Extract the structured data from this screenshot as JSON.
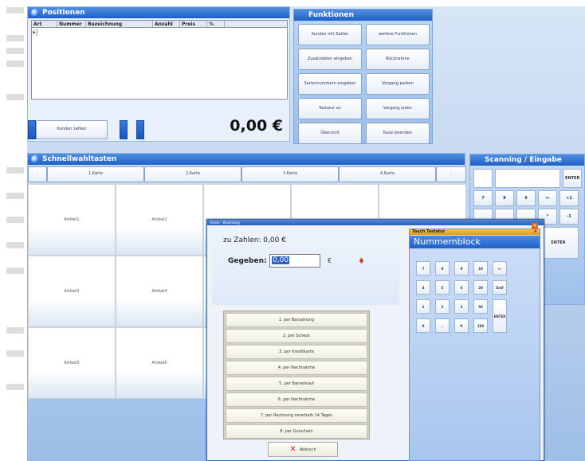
{
  "positions": {
    "title": "Positionen",
    "columns": [
      "Art",
      "Nummer",
      "Bezeichnung",
      "Anzahl",
      "Preis",
      "%"
    ],
    "row_marker": "▸",
    "pay_button": "Kunden zahlen",
    "total": "0,00 €"
  },
  "functions": {
    "title": "Funktionen",
    "buttons": [
      "Kunden mit Zahler",
      "weitere Funktionen",
      "Zusatzdaten eingeben",
      "Rücknahme",
      "Seriennummern eingeben",
      "Vorgang parken",
      "Tastatur an",
      "Vorgang laden",
      "Übersicht",
      "Kassi beenden"
    ]
  },
  "quick": {
    "title": "Schnellwahltasten",
    "tabs": [
      "-",
      "1.Karte",
      "2.Karte",
      "3.Karte",
      "4.Karte",
      "-"
    ],
    "articles": [
      "Artikel1",
      "Artikel2",
      "",
      "",
      "",
      "Artikel3",
      "Artikel4",
      "",
      "",
      "",
      "Artikel5",
      "Artikel6",
      "",
      "",
      ""
    ]
  },
  "scanning": {
    "title": "Scanning / Eingabe",
    "enter": "ENTER",
    "keys": [
      "7",
      "8",
      "9",
      "<-",
      "+1",
      "",
      "",
      "",
      "*",
      "-1",
      "",
      "",
      "",
      "",
      ""
    ]
  },
  "dialog": {
    "title": "Kasse - Bezahlung",
    "to_pay": "zu Zahlen: 0,00 €",
    "given_label": "Gegeben:",
    "given_value": "0,00",
    "currency": "€",
    "methods": [
      "1. per Barzahlung",
      "2. per Scheck",
      "3. per Kreditkarte",
      "4. per Nachnahme",
      "5. per Barverkauf",
      "6. per Nachnahme",
      "7. per Rechnung innerhalb 14 Tagen",
      "8. per Gutschein"
    ],
    "cancel": "Abbruch"
  },
  "touch": {
    "small_title": "Touch Tastatur",
    "title": "Nummernblock",
    "keys": [
      "7",
      "8",
      "9",
      "10",
      "<-",
      "4",
      "5",
      "6",
      "20",
      "Entf",
      "1",
      "2",
      "3",
      "50",
      "ENTER",
      "0",
      ",",
      "€",
      "100"
    ]
  }
}
